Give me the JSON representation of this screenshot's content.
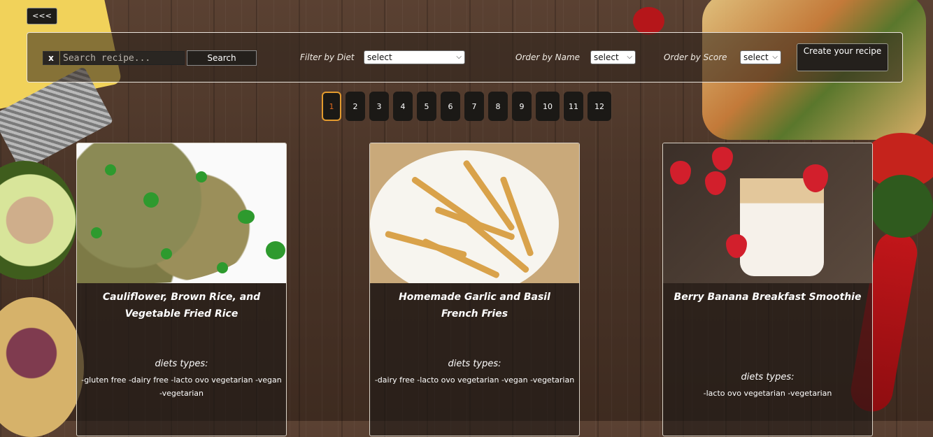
{
  "nav": {
    "back_label": "<<<"
  },
  "toolbar": {
    "clear_label": "x",
    "search_placeholder": "Search recipe...",
    "search_value": "",
    "search_button": "Search",
    "filter_diet_label": "Filter by Diet",
    "filter_diet_value": "select",
    "order_name_label": "Order by Name",
    "order_name_value": "select",
    "order_score_label": "Order by Score",
    "order_score_value": "select",
    "create_button": "Create your recipe"
  },
  "pagination": {
    "pages": [
      "1",
      "2",
      "3",
      "4",
      "5",
      "6",
      "7",
      "8",
      "9",
      "10",
      "11",
      "12"
    ],
    "current": "1",
    "active_color": "#e39b2e"
  },
  "recipes": [
    {
      "title": "Cauliflower, Brown Rice, and Vegetable Fried Rice",
      "diets_heading": "diets types:",
      "diets": "-gluten free -dairy free -lacto ovo vegetarian -vegan -vegetarian",
      "image": "fried-rice-photo"
    },
    {
      "title": "Homemade Garlic and Basil French Fries",
      "diets_heading": "diets types:",
      "diets": "-dairy free -lacto ovo vegetarian -vegan -vegetarian",
      "image": "french-fries-photo"
    },
    {
      "title": "Berry Banana Breakfast Smoothie",
      "diets_heading": "diets types:",
      "diets": "-lacto ovo vegetarian -vegetarian",
      "image": "smoothie-photo"
    }
  ]
}
